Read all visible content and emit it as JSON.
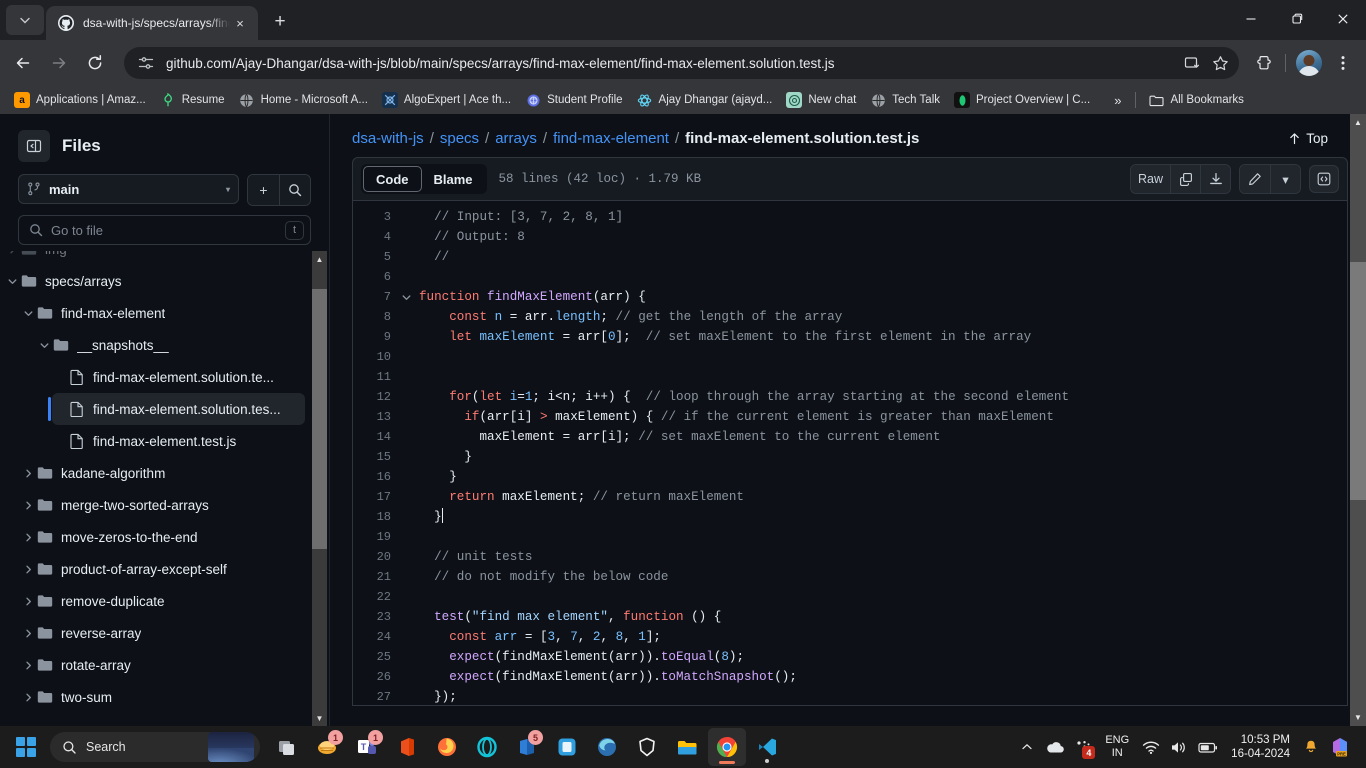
{
  "browser": {
    "tab": {
      "title": "dsa-with-js/specs/arrays/find-m",
      "favicon": "github-icon",
      "close_label": "×"
    },
    "new_tab_label": "+",
    "tab_list_label": "⌄",
    "window_controls": {
      "minimize": "–",
      "maximize": "❐",
      "close": "✕"
    },
    "nav": {
      "back": "←",
      "forward": "→",
      "reload": "↻"
    },
    "omnibox": {
      "url": "github.com/Ajay-Dhangar/dsa-with-js/blob/main/specs/arrays/find-max-element/find-max-element.solution.test.js",
      "site_info_icon": "tune-icon",
      "install_icon": "install-app-icon",
      "bookmark_icon": "star-icon"
    },
    "toolbar": {
      "extensions_icon": "extensions-icon",
      "profile_icon": "avatar",
      "menu_icon": "kebab-menu-icon"
    },
    "bookmarks": [
      {
        "label": "Applications | Amaz...",
        "icon": "amazon-icon",
        "color": "#ff9900"
      },
      {
        "label": "Resume",
        "icon": "resume-icon",
        "color": "#3ddc84"
      },
      {
        "label": "Home - Microsoft A...",
        "icon": "globe-icon",
        "color": "#9aa0a6"
      },
      {
        "label": "AlgoExpert | Ace th...",
        "icon": "algoexpert-icon",
        "color": "#1b3a5c"
      },
      {
        "label": "Student Profile",
        "icon": "brain-icon",
        "color": "#5b6ee1"
      },
      {
        "label": "Ajay Dhangar (ajayd...",
        "icon": "react-icon",
        "color": "#61dafb"
      },
      {
        "label": "New chat",
        "icon": "openai-icon",
        "color": "#74aa9c"
      },
      {
        "label": "Tech Talk",
        "icon": "globe-icon",
        "color": "#9aa0a6"
      },
      {
        "label": "Project Overview | C...",
        "icon": "leaf-icon",
        "color": "#1ec773"
      }
    ],
    "bookmarks_overflow": "»",
    "all_bookmarks_label": "All Bookmarks"
  },
  "sidebar": {
    "title": "Files",
    "toggle_icon": "sidebar-collapse-icon",
    "branch": {
      "name": "main",
      "icon": "branch-icon",
      "caret": "▾"
    },
    "add_label": "+",
    "search_label": "search-icon",
    "file_search": {
      "placeholder": "Go to file",
      "shortcut": "t",
      "icon": "search-icon"
    },
    "tree": [
      {
        "label": "img",
        "type": "folder",
        "depth": 0,
        "state": "collapsed",
        "partial": true,
        "selected": false
      },
      {
        "label": "specs/arrays",
        "type": "folder",
        "depth": 0,
        "state": "expanded",
        "selected": false
      },
      {
        "label": "find-max-element",
        "type": "folder",
        "depth": 1,
        "state": "expanded",
        "selected": false
      },
      {
        "label": "__snapshots__",
        "type": "folder",
        "depth": 2,
        "state": "expanded",
        "selected": false
      },
      {
        "label": "find-max-element.solution.te...",
        "type": "file",
        "depth": 3,
        "state": "none",
        "selected": false
      },
      {
        "label": "find-max-element.solution.tes...",
        "type": "file",
        "depth": 3,
        "state": "none",
        "selected": true
      },
      {
        "label": "find-max-element.test.js",
        "type": "file",
        "depth": 3,
        "state": "none",
        "selected": false
      },
      {
        "label": "kadane-algorithm",
        "type": "folder",
        "depth": 1,
        "state": "collapsed",
        "selected": false
      },
      {
        "label": "merge-two-sorted-arrays",
        "type": "folder",
        "depth": 1,
        "state": "collapsed",
        "selected": false
      },
      {
        "label": "move-zeros-to-the-end",
        "type": "folder",
        "depth": 1,
        "state": "collapsed",
        "selected": false
      },
      {
        "label": "product-of-array-except-self",
        "type": "folder",
        "depth": 1,
        "state": "collapsed",
        "selected": false
      },
      {
        "label": "remove-duplicate",
        "type": "folder",
        "depth": 1,
        "state": "collapsed",
        "selected": false
      },
      {
        "label": "reverse-array",
        "type": "folder",
        "depth": 1,
        "state": "collapsed",
        "selected": false
      },
      {
        "label": "rotate-array",
        "type": "folder",
        "depth": 1,
        "state": "collapsed",
        "selected": false
      },
      {
        "label": "two-sum",
        "type": "folder",
        "depth": 1,
        "state": "collapsed",
        "selected": false
      }
    ]
  },
  "content": {
    "breadcrumb": [
      {
        "label": "dsa-with-js",
        "current": false
      },
      {
        "label": "specs",
        "current": false
      },
      {
        "label": "arrays",
        "current": false
      },
      {
        "label": "find-max-element",
        "current": false
      },
      {
        "label": "find-max-element.solution.test.js",
        "current": true
      }
    ],
    "breadcrumb_separator": "/",
    "top_link": {
      "label": "Top",
      "icon": "arrow-up-icon"
    },
    "tabs": {
      "code": "Code",
      "blame": "Blame"
    },
    "file_meta": "58 lines (42 loc) · 1.79 KB",
    "actions": {
      "raw": "Raw",
      "copy_icon": "copy-icon",
      "download_icon": "download-icon",
      "edit_icon": "pencil-icon",
      "edit_caret": "▾",
      "symbols_icon": "code-brackets-icon"
    },
    "code_lines": [
      {
        "n": "3",
        "fold": false,
        "indent": 1,
        "tokens": [
          {
            "t": "// Input: [3, 7, 2, 8, 1]",
            "c": "c-com"
          }
        ]
      },
      {
        "n": "4",
        "fold": false,
        "indent": 1,
        "tokens": [
          {
            "t": "// Output: 8",
            "c": "c-com"
          }
        ]
      },
      {
        "n": "5",
        "fold": false,
        "indent": 1,
        "tokens": [
          {
            "t": "//",
            "c": "c-com"
          }
        ]
      },
      {
        "n": "6",
        "fold": false,
        "indent": 0,
        "tokens": []
      },
      {
        "n": "7",
        "fold": true,
        "indent": 0,
        "tokens": [
          {
            "t": "function ",
            "c": "c-kw"
          },
          {
            "t": "findMaxElement",
            "c": "c-fn"
          },
          {
            "t": "(arr) {",
            "c": "c-par"
          }
        ]
      },
      {
        "n": "8",
        "fold": false,
        "indent": 2,
        "tokens": [
          {
            "t": "const ",
            "c": "c-kw"
          },
          {
            "t": "n",
            "c": "c-var"
          },
          {
            "t": " = arr.",
            "c": "c-par"
          },
          {
            "t": "length",
            "c": "c-var"
          },
          {
            "t": "; ",
            "c": "c-par"
          },
          {
            "t": "// get the length of the array",
            "c": "c-com"
          }
        ]
      },
      {
        "n": "9",
        "fold": false,
        "indent": 2,
        "tokens": [
          {
            "t": "let ",
            "c": "c-kw"
          },
          {
            "t": "maxElement",
            "c": "c-var"
          },
          {
            "t": " = arr[",
            "c": "c-par"
          },
          {
            "t": "0",
            "c": "c-num"
          },
          {
            "t": "];  ",
            "c": "c-par"
          },
          {
            "t": "// set maxElement to the first element in the array",
            "c": "c-com"
          }
        ]
      },
      {
        "n": "10",
        "fold": false,
        "indent": 0,
        "tokens": []
      },
      {
        "n": "11",
        "fold": false,
        "indent": 0,
        "tokens": []
      },
      {
        "n": "12",
        "fold": false,
        "indent": 2,
        "tokens": [
          {
            "t": "for",
            "c": "c-kw"
          },
          {
            "t": "(",
            "c": "c-par"
          },
          {
            "t": "let ",
            "c": "c-kw"
          },
          {
            "t": "i",
            "c": "c-var"
          },
          {
            "t": "=",
            "c": "c-par"
          },
          {
            "t": "1",
            "c": "c-num"
          },
          {
            "t": "; i<n; i++) {  ",
            "c": "c-par"
          },
          {
            "t": "// loop through the array starting at the second element",
            "c": "c-com"
          }
        ]
      },
      {
        "n": "13",
        "fold": false,
        "indent": 3,
        "tokens": [
          {
            "t": "if",
            "c": "c-kw"
          },
          {
            "t": "(arr[i] ",
            "c": "c-par"
          },
          {
            "t": ">",
            "c": "c-kw"
          },
          {
            "t": " maxElement) { ",
            "c": "c-par"
          },
          {
            "t": "// if the current element is greater than maxElement",
            "c": "c-com"
          }
        ]
      },
      {
        "n": "14",
        "fold": false,
        "indent": 4,
        "tokens": [
          {
            "t": "maxElement = arr[i]; ",
            "c": "c-par"
          },
          {
            "t": "// set maxElement to the current element",
            "c": "c-com"
          }
        ]
      },
      {
        "n": "15",
        "fold": false,
        "indent": 3,
        "tokens": [
          {
            "t": "}",
            "c": "c-par"
          }
        ]
      },
      {
        "n": "16",
        "fold": false,
        "indent": 2,
        "tokens": [
          {
            "t": "}",
            "c": "c-par"
          }
        ]
      },
      {
        "n": "17",
        "fold": false,
        "indent": 2,
        "tokens": [
          {
            "t": "return ",
            "c": "c-kw"
          },
          {
            "t": "maxElement; ",
            "c": "c-par"
          },
          {
            "t": "// return maxElement",
            "c": "c-com"
          }
        ]
      },
      {
        "n": "18",
        "fold": false,
        "indent": 1,
        "tokens": [
          {
            "t": "}",
            "c": "c-par"
          }
        ],
        "cursor": true
      },
      {
        "n": "19",
        "fold": false,
        "indent": 0,
        "tokens": []
      },
      {
        "n": "20",
        "fold": false,
        "indent": 1,
        "tokens": [
          {
            "t": "// unit tests",
            "c": "c-com"
          }
        ]
      },
      {
        "n": "21",
        "fold": false,
        "indent": 1,
        "tokens": [
          {
            "t": "// do not modify the below code",
            "c": "c-com"
          }
        ]
      },
      {
        "n": "22",
        "fold": false,
        "indent": 0,
        "tokens": []
      },
      {
        "n": "23",
        "fold": false,
        "indent": 1,
        "tokens": [
          {
            "t": "test",
            "c": "c-fn"
          },
          {
            "t": "(",
            "c": "c-par"
          },
          {
            "t": "\"find max element\"",
            "c": "c-str"
          },
          {
            "t": ", ",
            "c": "c-par"
          },
          {
            "t": "function ",
            "c": "c-kw"
          },
          {
            "t": "() {",
            "c": "c-par"
          }
        ]
      },
      {
        "n": "24",
        "fold": false,
        "indent": 2,
        "tokens": [
          {
            "t": "const ",
            "c": "c-kw"
          },
          {
            "t": "arr",
            "c": "c-var"
          },
          {
            "t": " = [",
            "c": "c-par"
          },
          {
            "t": "3",
            "c": "c-num"
          },
          {
            "t": ", ",
            "c": "c-par"
          },
          {
            "t": "7",
            "c": "c-num"
          },
          {
            "t": ", ",
            "c": "c-par"
          },
          {
            "t": "2",
            "c": "c-num"
          },
          {
            "t": ", ",
            "c": "c-par"
          },
          {
            "t": "8",
            "c": "c-num"
          },
          {
            "t": ", ",
            "c": "c-par"
          },
          {
            "t": "1",
            "c": "c-num"
          },
          {
            "t": "];",
            "c": "c-par"
          }
        ]
      },
      {
        "n": "25",
        "fold": false,
        "indent": 2,
        "tokens": [
          {
            "t": "expect",
            "c": "c-fn"
          },
          {
            "t": "(findMaxElement(arr)).",
            "c": "c-par"
          },
          {
            "t": "toEqual",
            "c": "c-fn"
          },
          {
            "t": "(",
            "c": "c-par"
          },
          {
            "t": "8",
            "c": "c-num"
          },
          {
            "t": ");",
            "c": "c-par"
          }
        ]
      },
      {
        "n": "26",
        "fold": false,
        "indent": 2,
        "tokens": [
          {
            "t": "expect",
            "c": "c-fn"
          },
          {
            "t": "(findMaxElement(arr)).",
            "c": "c-par"
          },
          {
            "t": "toMatchSnapshot",
            "c": "c-fn"
          },
          {
            "t": "();",
            "c": "c-par"
          }
        ]
      },
      {
        "n": "27",
        "fold": false,
        "indent": 1,
        "tokens": [
          {
            "t": "});",
            "c": "c-par"
          }
        ]
      }
    ]
  },
  "taskbar": {
    "start_label": "start-icon",
    "search": {
      "label": "Search",
      "icon": "search-icon"
    },
    "apps": [
      {
        "name": "task-view-icon",
        "badge": "",
        "state": ""
      },
      {
        "name": "copilot-icon",
        "badge": "1",
        "state": ""
      },
      {
        "name": "microsoft-teams-icon",
        "badge": "1",
        "state": ""
      },
      {
        "name": "microsoft-office-icon",
        "badge": "",
        "state": ""
      },
      {
        "name": "firefox-icon",
        "badge": "",
        "state": ""
      },
      {
        "name": "opera-icon",
        "badge": "",
        "state": ""
      },
      {
        "name": "microsoft-store-icon",
        "badge": "5",
        "state": ""
      },
      {
        "name": "snipping-tool-icon",
        "badge": "",
        "state": ""
      },
      {
        "name": "microsoft-edge-icon",
        "badge": "",
        "state": ""
      },
      {
        "name": "brave-icon",
        "badge": "",
        "state": ""
      },
      {
        "name": "file-explorer-icon",
        "badge": "",
        "state": ""
      },
      {
        "name": "google-chrome-icon",
        "badge": "",
        "state": "active"
      },
      {
        "name": "vs-code-icon",
        "badge": "",
        "state": "open"
      }
    ],
    "tray": {
      "overflow": "˄",
      "cloud_icon": "onedrive-icon",
      "updates_icon": "updates-icon",
      "updates_badge": "4",
      "language": {
        "line1": "ENG",
        "line2": "IN"
      },
      "wifi_icon": "wifi-icon",
      "volume_icon": "volume-icon",
      "battery_icon": "battery-icon",
      "time": "10:53 PM",
      "date": "16-04-2024",
      "notification_icon": "bell-icon",
      "copilot_icon": "copilot-pre-icon",
      "copilot_badge": "PRE"
    }
  }
}
